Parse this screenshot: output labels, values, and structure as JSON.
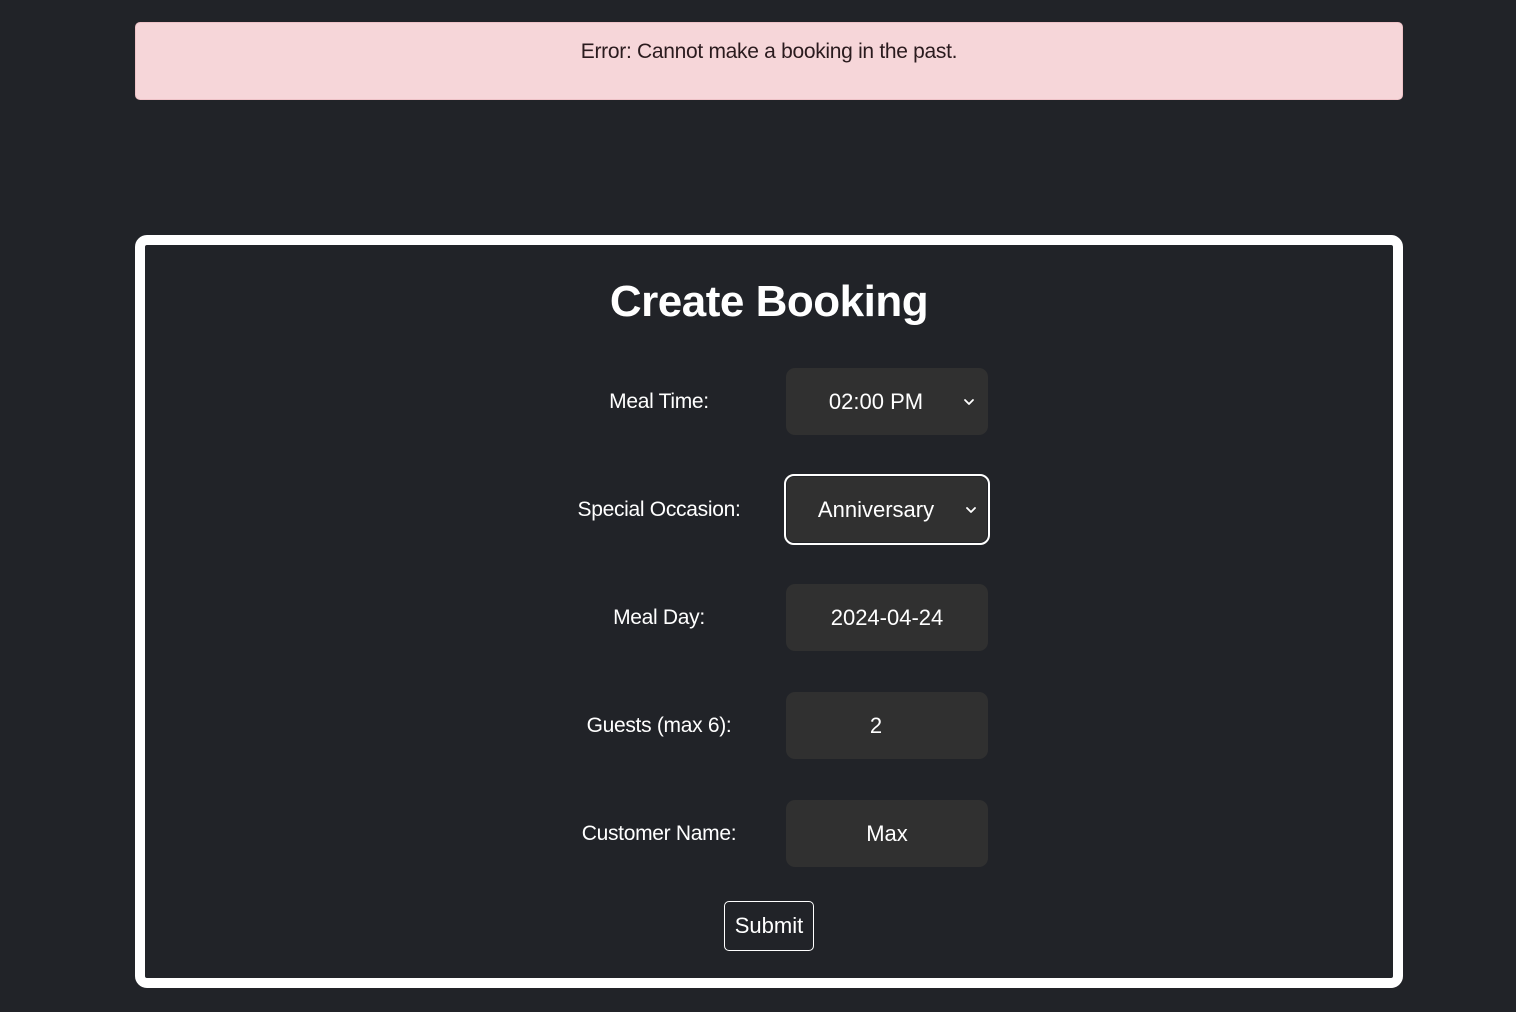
{
  "alert": {
    "message": "Error: Cannot make a booking in the past."
  },
  "form": {
    "title": "Create Booking",
    "fields": [
      {
        "label": "Meal Time:",
        "value": "02:00 PM",
        "type": "select"
      },
      {
        "label": "Special Occasion:",
        "value": "Anniversary",
        "type": "select",
        "focused": true
      },
      {
        "label": "Meal Day:",
        "value": "2024-04-24",
        "type": "date"
      },
      {
        "label": "Guests (max 6):",
        "value": "2",
        "type": "number"
      },
      {
        "label": "Customer Name:",
        "value": "Max",
        "type": "text"
      }
    ],
    "submit_label": "Submit"
  },
  "icons": {
    "select_chevron": "chevron-down-icon"
  },
  "colors": {
    "background": "#212328",
    "alert_background": "#f6d6d9",
    "field_background": "#303030",
    "card_border": "#ffffff"
  }
}
